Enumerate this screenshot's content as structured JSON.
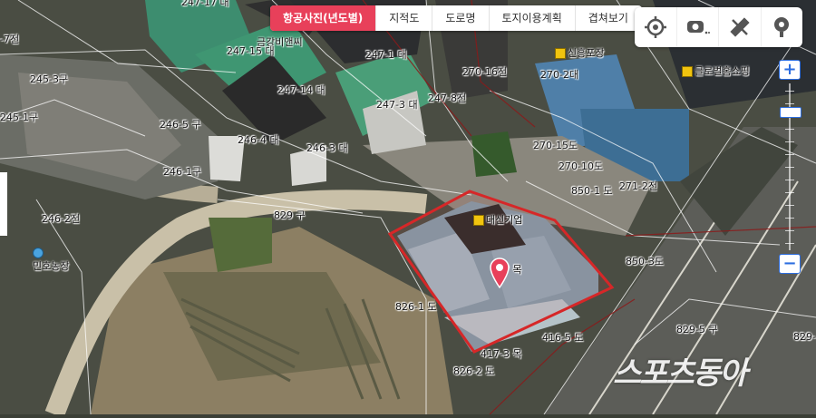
{
  "tabs": [
    {
      "label": "항공사진(년도별)",
      "active": true
    },
    {
      "label": "지적도",
      "active": false
    },
    {
      "label": "도로명",
      "active": false
    },
    {
      "label": "토지이용계획",
      "active": false
    },
    {
      "label": "겹쳐보기",
      "active": false
    }
  ],
  "tools": [
    "location-target-icon",
    "roadview-icon",
    "measure-ruler-icon",
    "pin-view-icon"
  ],
  "zoom": {
    "plus": "+",
    "minus": "−",
    "level_fraction": 0.15
  },
  "highlight_color": "#d62728",
  "parcels": [
    {
      "id": "p1",
      "text": "247-17 대"
    },
    {
      "id": "p2",
      "text": "-7전"
    },
    {
      "id": "p3",
      "text": "금강비앤씨"
    },
    {
      "id": "p4",
      "text": "247-15 대"
    },
    {
      "id": "p5",
      "text": "247-1 대"
    },
    {
      "id": "p6",
      "text": "245-3구"
    },
    {
      "id": "p7",
      "text": "247-14 대"
    },
    {
      "id": "p8",
      "text": "247-8전"
    },
    {
      "id": "p9",
      "text": "247-3 대"
    },
    {
      "id": "p10",
      "text": "270-16전"
    },
    {
      "id": "p11",
      "text": "270-2대"
    },
    {
      "id": "p12",
      "text": "245-1구"
    },
    {
      "id": "p13",
      "text": "246-5 구"
    },
    {
      "id": "p14",
      "text": "246-4 대"
    },
    {
      "id": "p15",
      "text": "246-3 대"
    },
    {
      "id": "p16",
      "text": "270-15도"
    },
    {
      "id": "p17",
      "text": "270-10도"
    },
    {
      "id": "p18",
      "text": "246-1구"
    },
    {
      "id": "p19",
      "text": "850-1 도"
    },
    {
      "id": "p20",
      "text": "271-2전"
    },
    {
      "id": "p21",
      "text": "246-2전"
    },
    {
      "id": "p22",
      "text": "829 구"
    },
    {
      "id": "p23",
      "text": "17 목"
    },
    {
      "id": "p24",
      "text": "850-3도"
    },
    {
      "id": "p25",
      "text": "826-1 도"
    },
    {
      "id": "p26",
      "text": "416-5 도"
    },
    {
      "id": "p27",
      "text": "417-3 목"
    },
    {
      "id": "p28",
      "text": "826-2 도"
    },
    {
      "id": "p29",
      "text": "829-5 구"
    },
    {
      "id": "p30",
      "text": "829-"
    }
  ],
  "pois": [
    {
      "id": "q1",
      "text": "신흥포장"
    },
    {
      "id": "q2",
      "text": "글로벌홈쇼핑"
    },
    {
      "id": "q3",
      "text": "대신기업"
    },
    {
      "id": "q4",
      "text": "민호농장"
    }
  ],
  "watermark": "스포츠동아"
}
